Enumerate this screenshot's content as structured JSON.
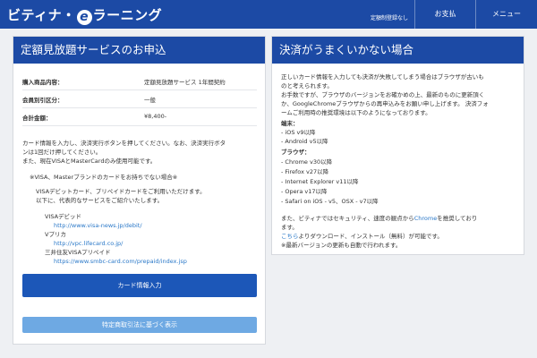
{
  "header": {
    "logo_prefix": "ビティナ・",
    "logo_mark": "e",
    "logo_suffix": "ラーニング",
    "user_label": "定額制登録なし",
    "nav_payment": "お支払",
    "nav_menu": "メニュー"
  },
  "left": {
    "title": "定額見放題サービスのお申込",
    "rows": [
      {
        "label": "購入商品内容：",
        "value": "定額見放題サービス 1年間契約"
      },
      {
        "label": "会員別引区分：",
        "value": "一般"
      },
      {
        "label": "合計金額：",
        "value": "¥8,400-"
      }
    ],
    "notice": [
      "カード情報を入力し、決済実行ボタンを押してください。なお、決済実行ボタ",
      "ンは1回だけ押してください。",
      "また、現在VISAとMasterCardのみ使用可能です。"
    ],
    "visa_note": "※VISA、Masterブランドのカードをお持ちでない場合※",
    "debit_intro": [
      "VISAデビットカード、プリペイドカードをご利用いただけます。",
      "以下に、代表的なサービスをご紹介いたします。"
    ],
    "services": [
      {
        "name": "VISAデビッド",
        "url": "http://www.visa-news.jp/debit/"
      },
      {
        "name": "Vプリカ",
        "url": "http://vpc.lifecard.co.jp/"
      },
      {
        "name": "三井住友VISAプリペイド",
        "url": "https://www.smbc-card.com/prepaid/index.jsp"
      }
    ],
    "card_button": "カード情報入力",
    "law_button": "特定商取引法に基づく表示"
  },
  "right": {
    "title": "決済がうまくいかない場合",
    "intro": [
      "正しいカード情報を入力しても決済が失敗してしまう場合はブラウザが古いも",
      "のと考えられます。",
      "お手数ですが、ブラウザのバージョンをお確かめの上、最新のものに更新頂く",
      "か、GoogleChromeブラウザからの再申込みをお願い申し上げます。 決済フォ",
      "ームご利用時の推奨環境は以下のようになっております。"
    ],
    "device_heading": "端末：",
    "devices": [
      "- iOS v9以降",
      "- Android v5以降"
    ],
    "browser_heading": "ブラウザ：",
    "browsers": [
      "- Chrome v30以降",
      "- Firefox v27以降",
      "- Internet Explorer v11以降",
      "- Opera v17以降",
      "- Safari on iOS - v5、OSX - v7以降"
    ],
    "rec_prefix": "また、ビティナではセキュリティ、速度の観点から",
    "rec_link": "Chrome",
    "rec_suffix": "を推奨しており",
    "rec_line2": "ます。",
    "dl_link": "こちら",
    "dl_suffix": "よりダウンロード、インストール（無料）が可能です。",
    "auto_update": "※最新バージョンの更新も自動で行われます。"
  },
  "colors": {
    "brand_blue": "#1c4aa5",
    "button_blue": "#1c57b8",
    "button_light": "#6ea9e3",
    "link": "#2a78c8"
  }
}
